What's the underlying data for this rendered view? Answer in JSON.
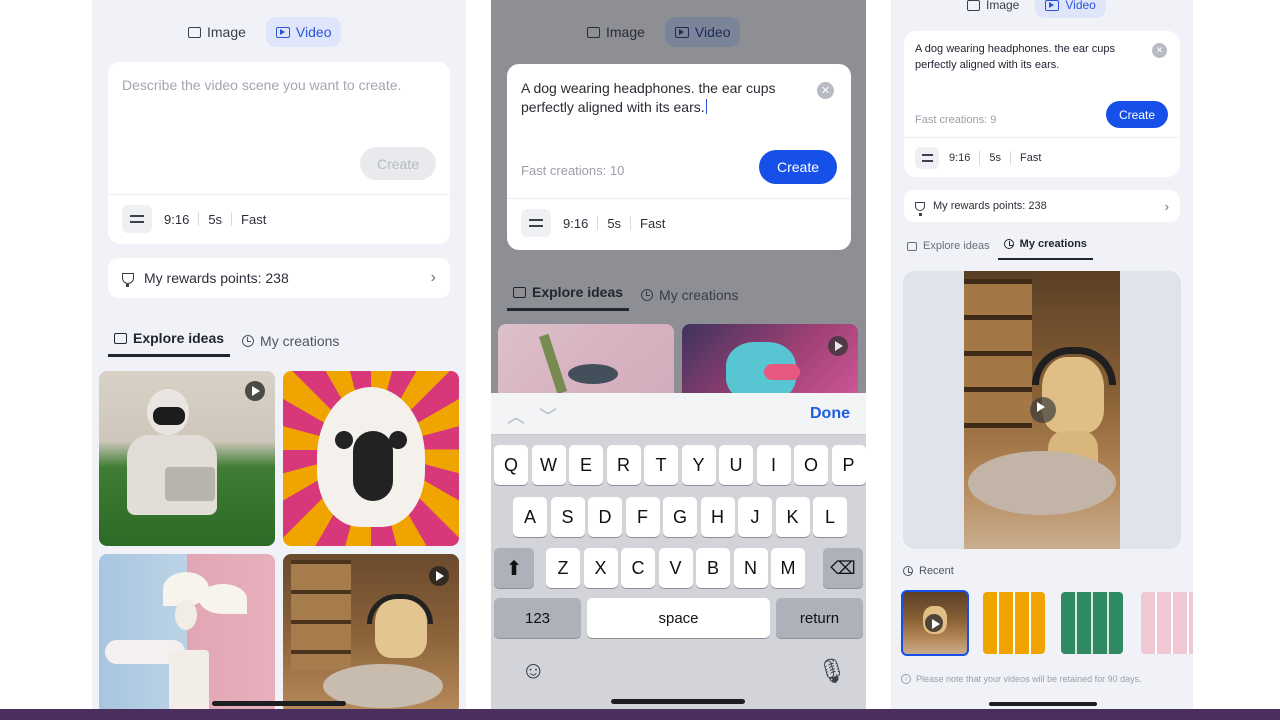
{
  "mode_tabs": {
    "image": "Image",
    "video": "Video"
  },
  "phone1": {
    "placeholder": "Describe the video scene you want to create.",
    "create": "Create",
    "settings": {
      "ratio": "9:16",
      "duration": "5s",
      "speed": "Fast"
    },
    "rewards": "My rewards points: 238",
    "tabs": {
      "explore": "Explore ideas",
      "mine": "My creations"
    }
  },
  "phone2": {
    "prompt": "A dog wearing headphones. the ear cups perfectly aligned with its ears.",
    "fast_creations": "Fast creations: 10",
    "create": "Create",
    "settings": {
      "ratio": "9:16",
      "duration": "5s",
      "speed": "Fast"
    },
    "tabs": {
      "explore": "Explore ideas",
      "mine": "My creations"
    },
    "keyboard": {
      "done": "Done",
      "row1": [
        "Q",
        "W",
        "E",
        "R",
        "T",
        "Y",
        "U",
        "I",
        "O",
        "P"
      ],
      "row2": [
        "A",
        "S",
        "D",
        "F",
        "G",
        "H",
        "J",
        "K",
        "L"
      ],
      "row3": [
        "Z",
        "X",
        "C",
        "V",
        "B",
        "N",
        "M"
      ],
      "numbers": "123",
      "space": "space",
      "return": "return"
    }
  },
  "phone3": {
    "prompt": "A dog wearing headphones. the ear cups perfectly aligned with its ears.",
    "fast_creations": "Fast creations: 9",
    "create": "Create",
    "settings": {
      "ratio": "9:16",
      "duration": "5s",
      "speed": "Fast"
    },
    "rewards": "My rewards points: 238",
    "tabs": {
      "explore": "Explore ideas",
      "mine": "My creations"
    },
    "recent": "Recent",
    "note": "Please note that your videos will be retained for 90 days."
  },
  "colors": {
    "accent": "#1650e8",
    "bottom_bar": "#4a2f5e",
    "tab_active_bg": "#dfe6fb"
  }
}
